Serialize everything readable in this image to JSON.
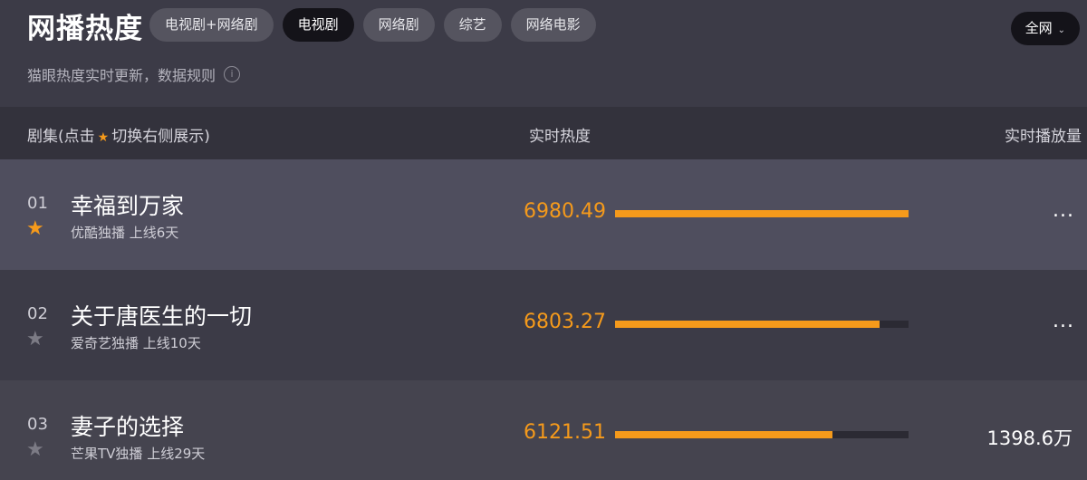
{
  "header": {
    "title": "网播热度",
    "tabs": [
      "电视剧+网络剧",
      "电视剧",
      "网络剧",
      "综艺",
      "网络电影"
    ],
    "active_tab": "电视剧",
    "scope_label": "全网",
    "scope_chevron": "⌄",
    "subtitle": "猫眼热度实时更新，数据规则",
    "info_glyph": "i"
  },
  "table": {
    "col_name_prefix": "剧集(点击",
    "col_name_suffix": "切换右侧展示)",
    "col_heat": "实时热度",
    "col_play": "实时播放量",
    "star_glyph": "★"
  },
  "rows": [
    {
      "rank": "01",
      "name": "幸福到万家",
      "meta": "优酷独播  上线6天",
      "heat": "6980.49",
      "heat_fraction": 1.0,
      "starred": true,
      "play": "..."
    },
    {
      "rank": "02",
      "name": "关于唐医生的一切",
      "meta": "爱奇艺独播  上线10天",
      "heat": "6803.27",
      "heat_fraction": 0.9,
      "starred": false,
      "play": "..."
    },
    {
      "rank": "03",
      "name": "妻子的选择",
      "meta": "芒果TV独播  上线29天",
      "heat": "6121.51",
      "heat_fraction": 0.74,
      "starred": false,
      "play": "1398.6万"
    }
  ],
  "colors": {
    "accent": "#f59a1b",
    "star_off": "#7c7b85"
  }
}
